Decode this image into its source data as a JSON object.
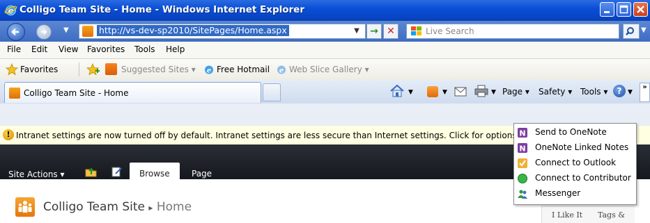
{
  "window": {
    "title": "Colligo Team Site - Home - Windows Internet Explorer"
  },
  "address_bar": {
    "url": "http://vs-dev-sp2010/SitePages/Home.aspx",
    "search_placeholder": "Live Search"
  },
  "menu_bar": {
    "items": [
      "File",
      "Edit",
      "View",
      "Favorites",
      "Tools",
      "Help"
    ]
  },
  "favorites_bar": {
    "favorites_label": "Favorites",
    "suggested_sites": "Suggested Sites",
    "free_hotmail": "Free Hotmail",
    "web_slice_gallery": "Web Slice Gallery"
  },
  "tabs": {
    "active_tab_title": "Colligo Team Site - Home"
  },
  "command_bar": {
    "page": "Page",
    "safety": "Safety",
    "tools": "Tools"
  },
  "info_bar": {
    "text": "Intranet settings are now turned off by default. Intranet settings are less secure than Internet settings. Click for options..."
  },
  "sharepoint": {
    "site_actions": "Site Actions",
    "tab_browse": "Browse",
    "tab_page": "Page",
    "site_name": "Colligo Team Site",
    "separator": "▸",
    "page_name": "Home",
    "i_like_it": "I Like It",
    "tags_notes": "Tags &"
  },
  "tools_menu": {
    "items": [
      {
        "label": "Send to OneNote",
        "icon": "onenote-icon"
      },
      {
        "label": "OneNote Linked Notes",
        "icon": "onenote-icon"
      },
      {
        "label": "Connect to Outlook",
        "icon": "outlook-icon"
      },
      {
        "label": "Connect to Contributor",
        "icon": "contributor-icon"
      },
      {
        "label": "Messenger",
        "icon": "messenger-icon"
      }
    ]
  },
  "colors": {
    "title_bar": "#0a4fd8",
    "info_bar_bg": "#ffffe1",
    "ribbon_bg": "#1e2129",
    "sharepoint_orange": "#e5770d"
  }
}
